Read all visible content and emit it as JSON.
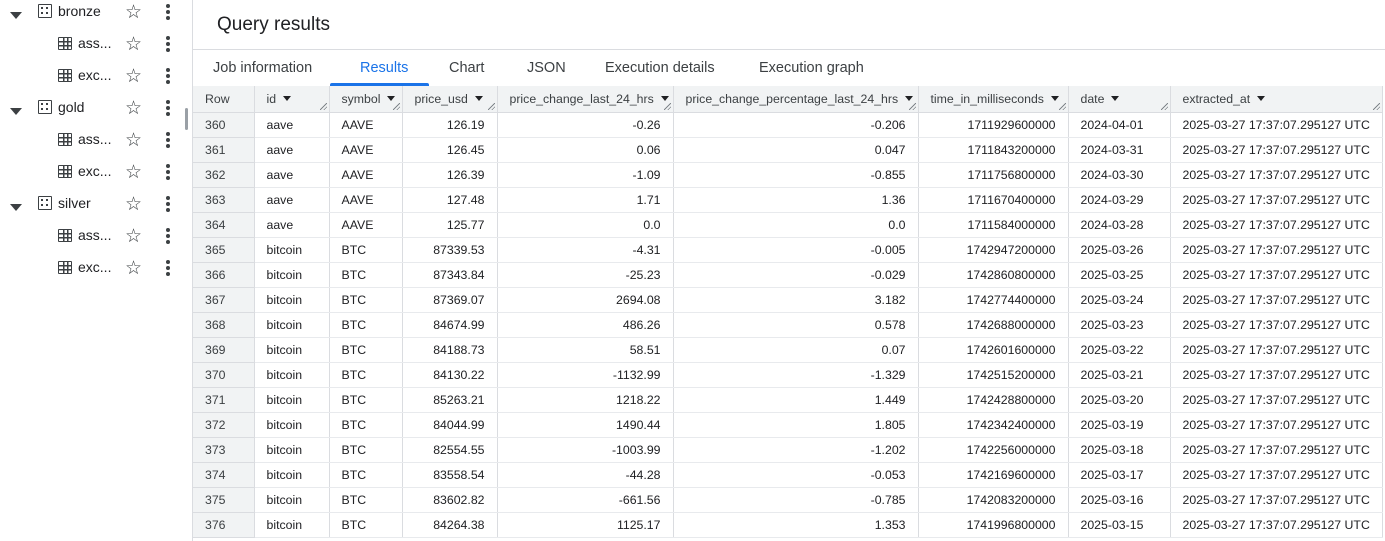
{
  "explorer": {
    "datasets": [
      {
        "name": "bronze",
        "tables": [
          "ass...",
          "exc..."
        ]
      },
      {
        "name": "gold",
        "tables": [
          "ass...",
          "exc..."
        ]
      },
      {
        "name": "silver",
        "tables": [
          "ass...",
          "exc..."
        ]
      }
    ]
  },
  "page": {
    "title": "Query results"
  },
  "tabs": [
    "Job information",
    "Results",
    "Chart",
    "JSON",
    "Execution details",
    "Execution graph"
  ],
  "active_tab": "Results",
  "columns": [
    "Row",
    "id",
    "symbol",
    "price_usd",
    "price_change_last_24_hrs",
    "price_change_percentage_last_24_hrs",
    "time_in_milliseconds",
    "date",
    "extracted_at"
  ],
  "rows": [
    [
      "360",
      "aave",
      "AAVE",
      "126.19",
      "-0.26",
      "-0.206",
      "1711929600000",
      "2024-04-01",
      "2025-03-27 17:37:07.295127 UTC"
    ],
    [
      "361",
      "aave",
      "AAVE",
      "126.45",
      "0.06",
      "0.047",
      "1711843200000",
      "2024-03-31",
      "2025-03-27 17:37:07.295127 UTC"
    ],
    [
      "362",
      "aave",
      "AAVE",
      "126.39",
      "-1.09",
      "-0.855",
      "1711756800000",
      "2024-03-30",
      "2025-03-27 17:37:07.295127 UTC"
    ],
    [
      "363",
      "aave",
      "AAVE",
      "127.48",
      "1.71",
      "1.36",
      "1711670400000",
      "2024-03-29",
      "2025-03-27 17:37:07.295127 UTC"
    ],
    [
      "364",
      "aave",
      "AAVE",
      "125.77",
      "0.0",
      "0.0",
      "1711584000000",
      "2024-03-28",
      "2025-03-27 17:37:07.295127 UTC"
    ],
    [
      "365",
      "bitcoin",
      "BTC",
      "87339.53",
      "-4.31",
      "-0.005",
      "1742947200000",
      "2025-03-26",
      "2025-03-27 17:37:07.295127 UTC"
    ],
    [
      "366",
      "bitcoin",
      "BTC",
      "87343.84",
      "-25.23",
      "-0.029",
      "1742860800000",
      "2025-03-25",
      "2025-03-27 17:37:07.295127 UTC"
    ],
    [
      "367",
      "bitcoin",
      "BTC",
      "87369.07",
      "2694.08",
      "3.182",
      "1742774400000",
      "2025-03-24",
      "2025-03-27 17:37:07.295127 UTC"
    ],
    [
      "368",
      "bitcoin",
      "BTC",
      "84674.99",
      "486.26",
      "0.578",
      "1742688000000",
      "2025-03-23",
      "2025-03-27 17:37:07.295127 UTC"
    ],
    [
      "369",
      "bitcoin",
      "BTC",
      "84188.73",
      "58.51",
      "0.07",
      "1742601600000",
      "2025-03-22",
      "2025-03-27 17:37:07.295127 UTC"
    ],
    [
      "370",
      "bitcoin",
      "BTC",
      "84130.22",
      "-1132.99",
      "-1.329",
      "1742515200000",
      "2025-03-21",
      "2025-03-27 17:37:07.295127 UTC"
    ],
    [
      "371",
      "bitcoin",
      "BTC",
      "85263.21",
      "1218.22",
      "1.449",
      "1742428800000",
      "2025-03-20",
      "2025-03-27 17:37:07.295127 UTC"
    ],
    [
      "372",
      "bitcoin",
      "BTC",
      "84044.99",
      "1490.44",
      "1.805",
      "1742342400000",
      "2025-03-19",
      "2025-03-27 17:37:07.295127 UTC"
    ],
    [
      "373",
      "bitcoin",
      "BTC",
      "82554.55",
      "-1003.99",
      "-1.202",
      "1742256000000",
      "2025-03-18",
      "2025-03-27 17:37:07.295127 UTC"
    ],
    [
      "374",
      "bitcoin",
      "BTC",
      "83558.54",
      "-44.28",
      "-0.053",
      "1742169600000",
      "2025-03-17",
      "2025-03-27 17:37:07.295127 UTC"
    ],
    [
      "375",
      "bitcoin",
      "BTC",
      "83602.82",
      "-661.56",
      "-0.785",
      "1742083200000",
      "2025-03-16",
      "2025-03-27 17:37:07.295127 UTC"
    ],
    [
      "376",
      "bitcoin",
      "BTC",
      "84264.38",
      "1125.17",
      "1.353",
      "1741996800000",
      "2025-03-15",
      "2025-03-27 17:37:07.295127 UTC"
    ]
  ],
  "colors": {
    "accent": "#1a73e8",
    "header_bg": "#f1f3f4",
    "border": "#dadce0"
  },
  "icons": {
    "expand": "caret-down-icon",
    "dataset": "dataset-icon",
    "table": "table-icon",
    "favorite": "star-icon",
    "more": "more-vert-icon",
    "sort": "sort-caret-icon"
  }
}
